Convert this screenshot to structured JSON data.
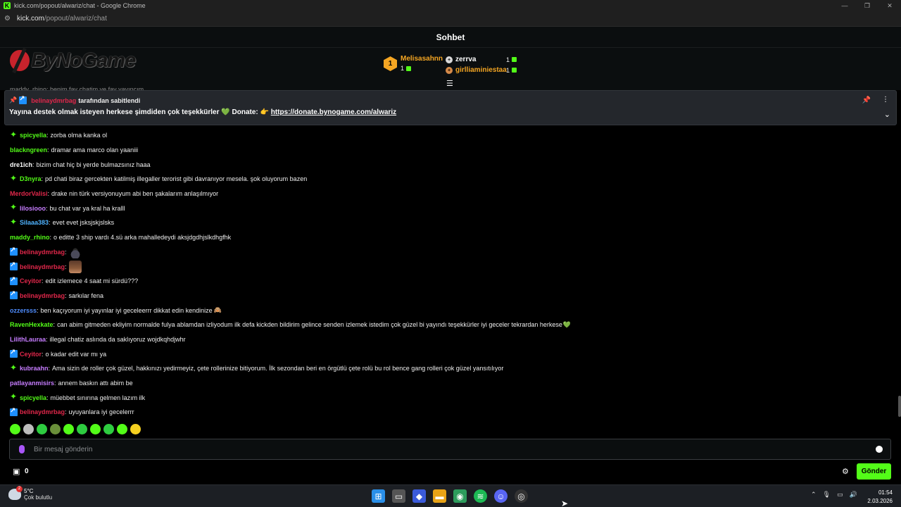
{
  "window": {
    "title": "kick.com/popout/alwariz/chat - Google Chrome",
    "controls": [
      "—",
      "❐",
      "✕"
    ]
  },
  "address": {
    "host": "kick.com",
    "path": "/popout/alwariz/chat"
  },
  "header": {
    "title": "Sohbet"
  },
  "banner": {
    "brand": "ByNoGame",
    "leader": {
      "rank": "1",
      "name": "Melisasahnn",
      "count": "1"
    },
    "runners": [
      {
        "name": "zerrva",
        "count": "1",
        "color": "#ffffff"
      },
      {
        "name": "girlliaminiestaa",
        "count": "1",
        "color": "#f5a623"
      }
    ]
  },
  "peek_text": "maddy_rhino: benim fav chatim ve fav yayıncım",
  "pinned": {
    "user": "belinaydmrbag",
    "by_label": "tarafından sabitlendi",
    "text": "Yayına destek olmak isteyen herkese şimdiden çok teşekkürler 💚 Donate: 👉 ",
    "link": "https://donate.bynogame.com/alwariz"
  },
  "messages": [
    {
      "badge": "sub",
      "user": "spicyella",
      "color": "#53fc18",
      "text": "zorba olma kanka ol"
    },
    {
      "badge": "",
      "user": "blackngreen",
      "color": "#53fc18",
      "text": "dramar ama marco olan yaaniii"
    },
    {
      "badge": "",
      "user": "dre1ich",
      "color": "#ffffff",
      "text": "bizim chat hiç bi yerde bulmazsınız haaa"
    },
    {
      "badge": "sub",
      "user": "D3nyra",
      "color": "#53fc18",
      "text": "pd chati biraz gercekten katilmiş illegaller terorist gibi davranıyor mesela. şok oluyorum bazen"
    },
    {
      "badge": "",
      "user": "MerdorValisi",
      "color": "#e0274a",
      "text": "drake nin türk versiyonuyum abi ben şakalarım anlaşılmıyor"
    },
    {
      "badge": "sub",
      "user": "lilosiooo",
      "color": "#c77dff",
      "text": "bu chat var ya kral ha kralll"
    },
    {
      "badge": "sub",
      "user": "Silaaa383",
      "color": "#4fb3ff",
      "text": "evet evet jsksjskjslsks"
    },
    {
      "badge": "",
      "user": "maddy_rhino",
      "color": "#53fc18",
      "text": "o editte 3 ship vardı 4.sü arka mahalledeydi aksjdgdhjslkdhgfhk"
    },
    {
      "badge": "mod",
      "user": "belinaydmrbag",
      "color": "#e0274a",
      "text": "",
      "emote": "hat"
    },
    {
      "badge": "mod",
      "user": "belinaydmrbag",
      "color": "#e0274a",
      "text": "",
      "emote": "face"
    },
    {
      "badge": "mod",
      "user": "Ceyitor",
      "color": "#e0274a",
      "text": "edit izlemece 4 saat mi sürdü???"
    },
    {
      "badge": "mod",
      "user": "belinaydmrbag",
      "color": "#e0274a",
      "text": "sarkılar fena"
    },
    {
      "badge": "",
      "user": "ozzersss",
      "color": "#4f8dff",
      "text": "ben kaçıyorum iyi yayınlar iyi geceleerrr dikkat edin kendinize",
      "suffix": "🙈"
    },
    {
      "badge": "",
      "user": "RavenHexkate",
      "color": "#53fc18",
      "text": "can abim gitmeden ekliyim normalde fulya ablamdan izliyodum ilk defa kickden bildirim gelince senden izlemek istedim çok güzel bi yayındı teşekkürler iyi geceler tekrardan herkese",
      "suffix": "💚"
    },
    {
      "badge": "",
      "user": "LilithLauraa",
      "color": "#c77dff",
      "text": "illegal chatiz aslında da saklıyoruz wojdkqhdjwhr"
    },
    {
      "badge": "mod",
      "user": "Ceyitor",
      "color": "#e0274a",
      "text": "o kadar edit var mı ya"
    },
    {
      "badge": "sub",
      "user": "kubraahn",
      "color": "#c77dff",
      "text": "Ama sizin de roller çok güzel, hakkınızı yedirmeyiz, çete rollerinize bitiyorum. İlk sezondan beri en örgütlü çete rolü bu rol bence gang rolleri çok güzel yansıtılıyor"
    },
    {
      "badge": "",
      "user": "patlayanmisirs",
      "color": "#c77dff",
      "text": "annem baskın attı abim be"
    },
    {
      "badge": "sub",
      "user": "spicyella",
      "color": "#53fc18",
      "text": "müebbet sınırına gelmen lazım ilk"
    },
    {
      "badge": "mod",
      "user": "belinaydmrbag",
      "color": "#e0274a",
      "text": "uyuyanlara iyi gecelerrr"
    }
  ],
  "emote_bar": [
    "#53fc18",
    "#bdbdbd",
    "#2ecc40",
    "#6a8f3a",
    "#53fc18",
    "#2ecc40",
    "#53fc18",
    "#2ecc40",
    "#53fc18",
    "#f5d020"
  ],
  "input": {
    "placeholder": "Bir mesaj gönderin"
  },
  "bottom": {
    "points": "0",
    "send_label": "Gönder"
  },
  "taskbar": {
    "temp": "5°C",
    "weather": "Çok bulutlu",
    "time": "01:54",
    "date": "2.03.2026"
  },
  "colors": {
    "accent": "#53fc18",
    "mod": "#1e90ff"
  }
}
